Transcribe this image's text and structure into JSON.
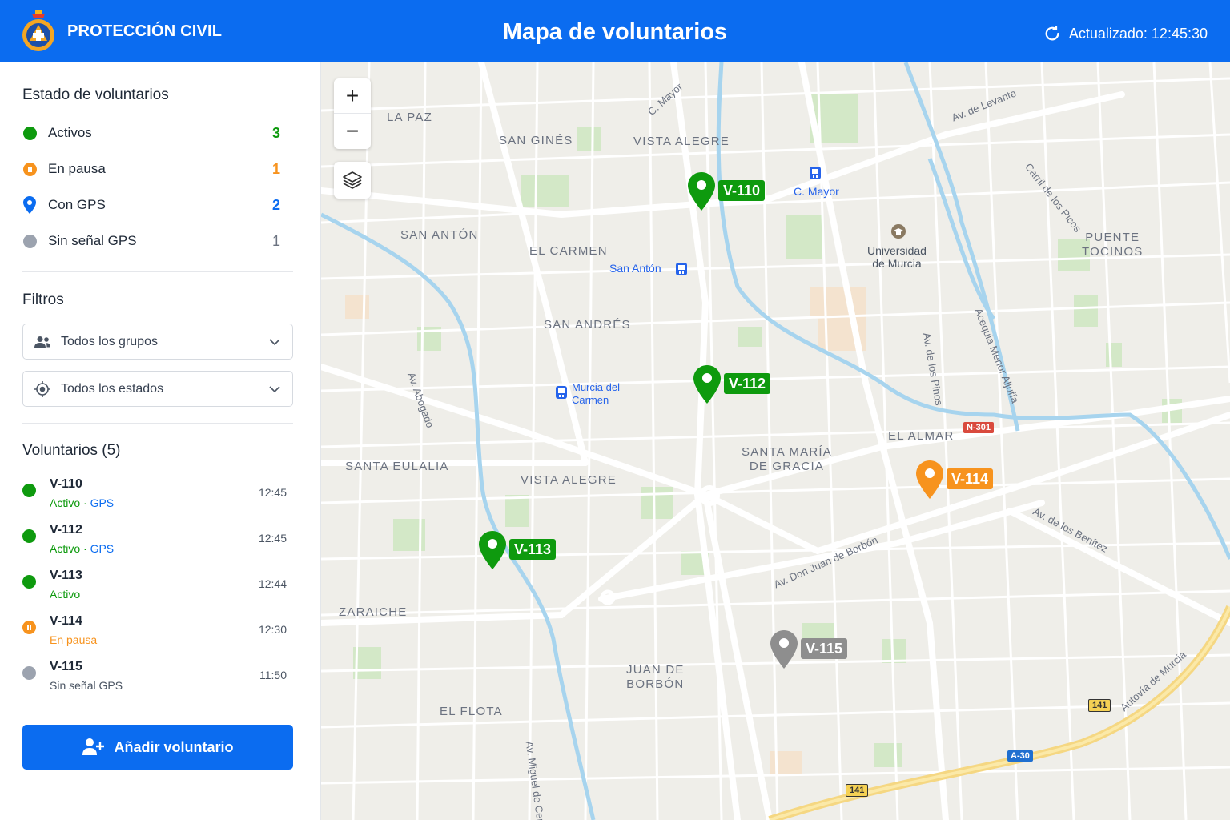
{
  "header": {
    "brand": "PROTECCIÓN CIVIL",
    "title": "Mapa de voluntarios",
    "updated": "Actualizado: 12:45:30"
  },
  "colors": {
    "primary": "#0b6cf0",
    "active": "#0e9a0e",
    "paused": "#f7931e",
    "gps": "#0b6cf0",
    "no_signal": "#9ca3af"
  },
  "status": {
    "title": "Estado de voluntarios",
    "items": [
      {
        "label": "Activos",
        "count": "3",
        "icon": "green-dot-icon"
      },
      {
        "label": "En pausa",
        "count": "1",
        "icon": "pause-icon"
      },
      {
        "label": "Con GPS",
        "count": "2",
        "icon": "location-pin-icon"
      },
      {
        "label": "Sin señal GPS",
        "count": "1",
        "icon": "gray-dot-icon"
      }
    ]
  },
  "filters": {
    "title": "Filtros",
    "group": "Todos los grupos",
    "state": "Todos los estados"
  },
  "volunteers": {
    "title": "Voluntarios (5)",
    "items": [
      {
        "id": "V-110",
        "status": "Activo",
        "gps": "GPS",
        "time": "12:45"
      },
      {
        "id": "V-112",
        "status": "Activo",
        "gps": "GPS",
        "time": "12:45"
      },
      {
        "id": "V-113",
        "status": "Activo",
        "gps": "",
        "time": "12:44"
      },
      {
        "id": "V-114",
        "status": "En pausa",
        "gps": "",
        "time": "12:30"
      },
      {
        "id": "V-115",
        "status": "Sin señal GPS",
        "gps": "",
        "time": "11:50"
      }
    ]
  },
  "add_button": "Añadir voluntario",
  "map": {
    "zoom_in": "+",
    "zoom_out": "−",
    "districts": [
      "LA PAZ",
      "SAN GINÉS",
      "VISTA ALEGRE",
      "SAN ANTÓN",
      "EL CARMEN",
      "SAN ANDRÉS",
      "PUENTE\nTOCINOS",
      "SANTA MARÍA\nDE GRACIA",
      "VISTA ALEGRE",
      "SANTA EULALIA",
      "ZARAICHE",
      "JUAN DE\nBORBÓN",
      "EL FLOTA",
      "EL ALMAR"
    ],
    "streets": [
      "C. Mayor",
      "Av. de Levante",
      "Carril de los Picos",
      "Acequia Menor Aljufía",
      "Av. de los Pinos",
      "Av. Abogado",
      "Av. de los Benítez",
      "Av. Don Juan de Borbón",
      "Av. Miguel de Cervantes",
      "Autovía de Murcia"
    ],
    "pois": [
      "San Antón",
      "C. Mayor",
      "Murcia del\nCarmen",
      "Universidad\nde Murcia"
    ],
    "roads": [
      "N-301",
      "A-30",
      "141",
      "141"
    ],
    "markers": [
      "V-110",
      "V-112",
      "V-113",
      "V-114",
      "V-115"
    ]
  }
}
